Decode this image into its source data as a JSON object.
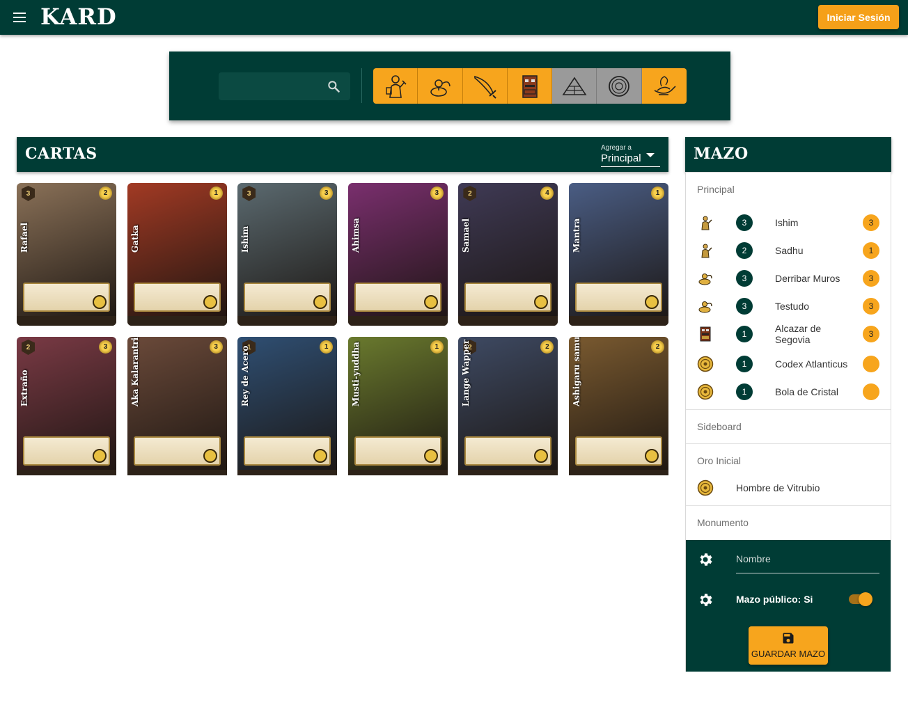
{
  "appbar": {
    "logo": "KARD",
    "login_label": "Iniciar Sesión"
  },
  "filters": {
    "search_placeholder": "",
    "types": [
      {
        "icon": "ally-icon",
        "active": true
      },
      {
        "icon": "talisman-icon",
        "active": true
      },
      {
        "icon": "weapon-icon",
        "active": true
      },
      {
        "icon": "totem-icon",
        "active": true
      },
      {
        "icon": "pyramid-icon",
        "active": false
      },
      {
        "icon": "coin-icon",
        "active": false
      },
      {
        "icon": "genie-lamp-icon",
        "active": true
      }
    ]
  },
  "cartas": {
    "title": "CARTAS",
    "agregar_label": "Agregar a",
    "agregar_value": "Principal",
    "cards": [
      {
        "name": "Rafael",
        "level": "3",
        "cost": "2",
        "bg": "#8a7158"
      },
      {
        "name": "Gatka",
        "level": "",
        "cost": "1",
        "bg": "#a23a24"
      },
      {
        "name": "Ishim",
        "level": "3",
        "cost": "3",
        "bg": "#5b6a70"
      },
      {
        "name": "Ahimsa",
        "level": "",
        "cost": "3",
        "bg": "#7a2f6e"
      },
      {
        "name": "Samael",
        "level": "2",
        "cost": "4",
        "bg": "#3f3a55"
      },
      {
        "name": "Mantra",
        "level": "",
        "cost": "1",
        "bg": "#4a5d84"
      },
      {
        "name": "Extraño",
        "level": "2",
        "cost": "3",
        "bg": "#7a3a45"
      },
      {
        "name": "Aka Kalarantri",
        "level": "",
        "cost": "3",
        "bg": "#6b4a3a"
      },
      {
        "name": "Rey de Acero",
        "level": "1",
        "cost": "1",
        "bg": "#2f4f73"
      },
      {
        "name": "Musti-yuddha",
        "level": "",
        "cost": "1",
        "bg": "#6a7a2e"
      },
      {
        "name": "Lange Wapper",
        "level": "2",
        "cost": "2",
        "bg": "#3e4a63"
      },
      {
        "name": "Ashigaru samurai",
        "level": "",
        "cost": "2",
        "bg": "#7a5a30"
      }
    ]
  },
  "mazo": {
    "title": "MAZO",
    "principal_label": "Principal",
    "principal": [
      {
        "icon": "ally-icon",
        "qty": "3",
        "name": "Ishim",
        "cost": "3"
      },
      {
        "icon": "ally-icon",
        "qty": "2",
        "name": "Sadhu",
        "cost": "1"
      },
      {
        "icon": "talisman-icon",
        "qty": "3",
        "name": "Derribar Muros",
        "cost": "3"
      },
      {
        "icon": "talisman-icon",
        "qty": "3",
        "name": "Testudo",
        "cost": "3"
      },
      {
        "icon": "totem-icon",
        "qty": "1",
        "name": "Alcazar de Segovia",
        "cost": "3"
      },
      {
        "icon": "gold-icon",
        "qty": "1",
        "name": "Codex Atlanticus",
        "cost": ""
      },
      {
        "icon": "gold-icon",
        "qty": "1",
        "name": "Bola de Cristal",
        "cost": ""
      }
    ],
    "sideboard_label": "Sideboard",
    "oro_label": "Oro Inicial",
    "oro_name": "Hombre de Vitrubio",
    "monumento_label": "Monumento",
    "nombre_placeholder": "Nombre",
    "publico_label": "Mazo público: Si",
    "publico_on": true,
    "guardar_label": "GUARDAR MAZO"
  },
  "colors": {
    "primary": "#003c35",
    "accent": "#f7a51d",
    "inactive": "#9a9a9a"
  }
}
